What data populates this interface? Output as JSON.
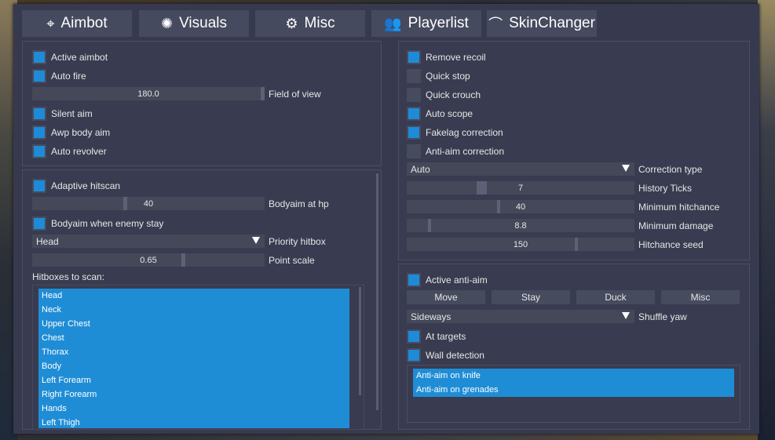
{
  "tabs": [
    {
      "label": "Aimbot",
      "icon": "crosshair-icon",
      "glyph": "⌖"
    },
    {
      "label": "Visuals",
      "icon": "sun-icon",
      "glyph": "✺"
    },
    {
      "label": "Misc",
      "icon": "gears-icon",
      "glyph": "⚙"
    },
    {
      "label": "Playerlist",
      "icon": "users-icon",
      "glyph": "👥"
    },
    {
      "label": "SkinChanger",
      "icon": "knife-icon",
      "glyph": "⌒"
    }
  ],
  "aim_general": {
    "active_aimbot": {
      "label": "Active aimbot",
      "checked": true
    },
    "auto_fire": {
      "label": "Auto fire",
      "checked": true
    },
    "fov": {
      "value": "180.0",
      "label": "Field of view",
      "fraction": 1.0
    },
    "silent_aim": {
      "label": "Silent aim",
      "checked": true
    },
    "awp_body_aim": {
      "label": "Awp body aim",
      "checked": true
    },
    "auto_revolver": {
      "label": "Auto revolver",
      "checked": true
    }
  },
  "hitscan": {
    "adaptive_hitscan": {
      "label": "Adaptive hitscan",
      "checked": true
    },
    "bodyaim_hp": {
      "value": "40",
      "label": "Bodyaim at hp",
      "fraction": 0.4
    },
    "bodyaim_stay": {
      "label": "Bodyaim when enemy stay",
      "checked": true
    },
    "priority_hitbox": {
      "value": "Head",
      "label": "Priority hitbox"
    },
    "point_scale": {
      "value": "0.65",
      "label": "Point scale",
      "fraction": 0.65
    },
    "hitboxes_title": "Hitboxes to scan:",
    "hitboxes": [
      "Head",
      "Neck",
      "Upper Chest",
      "Chest",
      "Thorax",
      "Body",
      "Left Forearm",
      "Right Forearm",
      "Hands",
      "Left Thigh"
    ]
  },
  "accuracy": {
    "remove_recoil": {
      "label": "Remove recoil",
      "checked": true
    },
    "quick_stop": {
      "label": "Quick stop",
      "checked": false
    },
    "quick_crouch": {
      "label": "Quick crouch",
      "checked": false
    },
    "auto_scope": {
      "label": "Auto scope",
      "checked": true
    },
    "fakelag_correction": {
      "label": "Fakelag correction",
      "checked": true
    },
    "antiaim_correction": {
      "label": "Anti-aim correction",
      "checked": false
    },
    "correction_type": {
      "value": "Auto",
      "label": "Correction type"
    },
    "history_ticks": {
      "value": "7",
      "label": "History Ticks",
      "fraction": 0.32
    },
    "min_hitchance": {
      "value": "40",
      "label": "Minimum hitchance",
      "fraction": 0.4
    },
    "min_damage": {
      "value": "8.8",
      "label": "Minimum damage",
      "fraction": 0.09
    },
    "hitchance_seed": {
      "value": "150",
      "label": "Hitchance seed",
      "fraction": 0.75
    }
  },
  "antiaim": {
    "active": {
      "label": "Active anti-aim",
      "checked": true
    },
    "modes": [
      "Move",
      "Stay",
      "Duck",
      "Misc"
    ],
    "shuffle_yaw": {
      "value": "Sideways",
      "label": "Shuffle yaw"
    },
    "at_targets": {
      "label": "At targets",
      "checked": true
    },
    "wall_detection": {
      "label": "Wall detection",
      "checked": true
    },
    "list": [
      "Anti-aim on knife",
      "Anti-aim on grenades"
    ]
  },
  "colors": {
    "accent": "#1e8bd8",
    "window": "#373a4e",
    "control": "#444859"
  }
}
